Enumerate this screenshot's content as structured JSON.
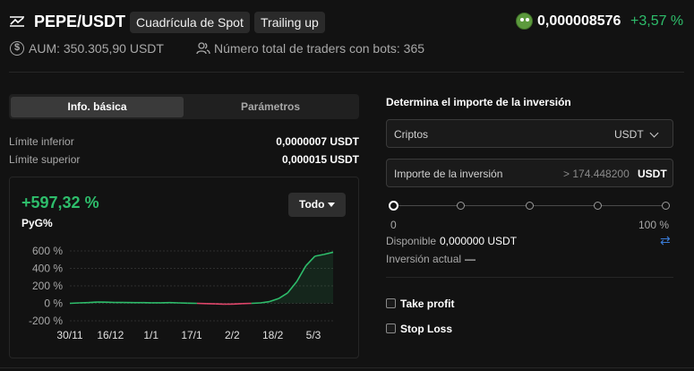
{
  "header": {
    "pair": "PEPE/USDT",
    "tag_strategy": "Cuadrícula de Spot",
    "tag_trailing": "Trailing up",
    "price": "0,000008576",
    "change": "+3,57 %",
    "aum": "AUM: 350.305,90 USDT",
    "traders": "Número total de traders con bots: 365"
  },
  "tabs": {
    "basic": "Info. básica",
    "params": "Parámetros"
  },
  "info": {
    "lower_label": "Límite inferior",
    "lower_value": "0,0000007 USDT",
    "upper_label": "Límite superior",
    "upper_value": "0,000015 USDT"
  },
  "pnl": {
    "value": "+597,32 %",
    "label": "PyG%",
    "range_button": "Todo"
  },
  "chart_data": {
    "type": "line",
    "y_ticks": [
      "600 %",
      "400 %",
      "200 %",
      "0 %",
      "-200 %"
    ],
    "x_ticks": [
      "30/11",
      "16/12",
      "1/1",
      "17/1",
      "2/2",
      "18/2",
      "5/3"
    ],
    "ylim": [
      -200,
      600
    ],
    "series": [
      {
        "values": [
          0,
          5,
          8,
          15,
          13,
          10,
          10,
          8,
          8,
          6,
          6,
          8,
          5,
          2,
          0,
          -3,
          -6,
          -10,
          -8,
          -3,
          0,
          5,
          20,
          55,
          120,
          250,
          430,
          540,
          560,
          585
        ]
      }
    ],
    "colors": {
      "positive": "#2ebd6b",
      "negative": "#e0466b"
    }
  },
  "invest": {
    "title": "Determina el importe de la inversión",
    "crypto_label": "Criptos",
    "crypto_value": "USDT",
    "amount_label": "Importe de la inversión",
    "amount_placeholder": "> 174.448200",
    "amount_unit": "USDT",
    "slider_min": "0",
    "slider_max": "100 %",
    "available_label": "Disponible",
    "available_value": "0,000000 USDT",
    "current_label": "Inversión actual",
    "current_value": "—",
    "take_profit": "Take profit",
    "stop_loss": "Stop Loss"
  }
}
